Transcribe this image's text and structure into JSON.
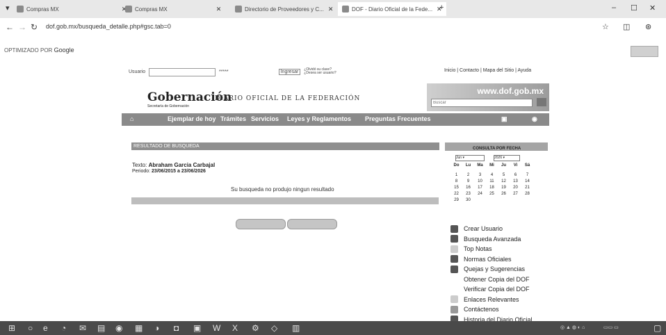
{
  "tabs": [
    {
      "label": "Compras MX"
    },
    {
      "label": "Compras MX"
    },
    {
      "label": "Directorio de Proveedores y C..."
    },
    {
      "label": "DOF - Diario Oficial de la Fede..."
    }
  ],
  "address": {
    "url": "dof.gob.mx/busqueda_detalle.php#gsc.tab=0"
  },
  "google_bar": {
    "prefix": "OPTIMIZADO POR",
    "brand": "Google"
  },
  "login": {
    "user_label": "Usuario",
    "password_value": "*****",
    "login_button": "Ingresar",
    "forgot": "¿Olvidó su clave?",
    "register": "¿Desea ser usuario?"
  },
  "top_links": "Inicio | Contacto | Mapa del Sitio | Ayuda",
  "header": {
    "logo_title": "Gobernación",
    "logo_sub": "Secretaría de Gobernación",
    "diario": "DIARIO OFICIAL DE LA FEDERACIÓN",
    "site": "www.dof.gob.mx",
    "search_placeholder": "Buscar"
  },
  "menu": [
    "Ejemplar de hoy",
    "Trámites",
    "Servicios",
    "Leyes y Reglamentos",
    "Preguntas Frecuentes"
  ],
  "results": {
    "header": "RESULTADO DE BUSQUEDA",
    "texto_label": "Texto:",
    "texto_value": "Abraham Garcia Carbajal",
    "periodo_label": "Periodo:",
    "periodo_value": "23/06/2015 a 23/06/2026",
    "no_result": "Su busqueda no produjo ningun resultado"
  },
  "calendar": {
    "title": "CONSULTA POR FECHA",
    "month": "Jun",
    "year": "2026",
    "days": [
      "Do",
      "Lu",
      "Ma",
      "Mi",
      "Ju",
      "Vi",
      "Sá"
    ],
    "weeks": [
      [
        "",
        "1",
        "2",
        "3",
        "4",
        "5",
        "6",
        "7"
      ],
      [
        "8",
        "9",
        "10",
        "11",
        "12",
        "13",
        "14"
      ],
      [
        "15",
        "16",
        "17",
        "18",
        "19",
        "20",
        "21"
      ],
      [
        "22",
        "23",
        "24",
        "25",
        "26",
        "27",
        "28"
      ],
      [
        "29",
        "30"
      ]
    ]
  },
  "sidebar": [
    "Crear Usuario",
    "Busqueda Avanzada",
    "Top Notas",
    "Normas Oficiales",
    "Quejas y Sugerencias",
    "Obtener Copia del DOF",
    "Verificar Copia del DOF",
    "Enlaces Relevantes",
    "Contáctenos",
    "Historia del Diario Oficial"
  ]
}
